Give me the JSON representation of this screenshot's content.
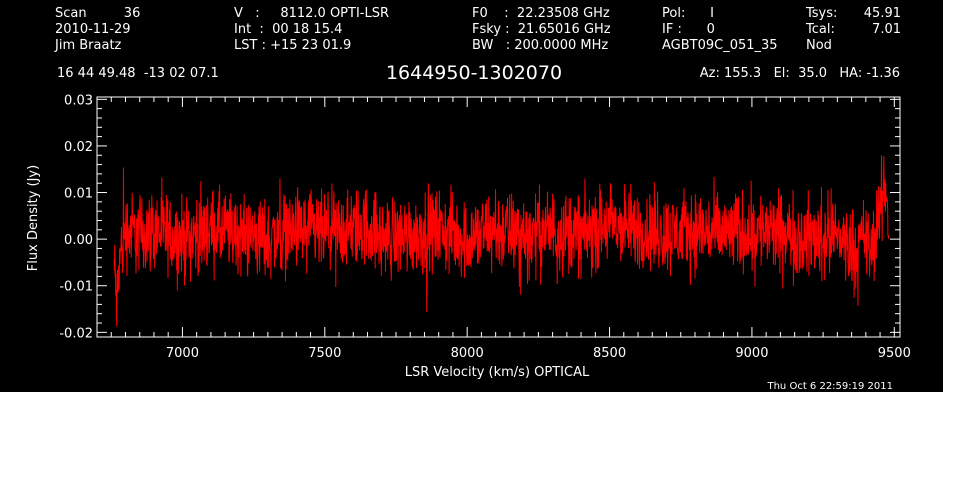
{
  "header": {
    "col1": [
      "Scan         36",
      "2010-11-29",
      "Jim Braatz"
    ],
    "col2": [
      "V   :     8112.0 OPTI-LSR",
      "Int  :  00 18 15.4",
      "LST : +15 23 01.9"
    ],
    "col3": [
      "F0    :  22.23508 GHz",
      "Fsky :  21.65016 GHz",
      "BW   : 200.0000 MHz"
    ],
    "col4": [
      "Pol:      I",
      "IF :      0",
      "AGBT09C_051_35"
    ],
    "col5": [
      "Tsys:",
      "Tcal:",
      "Nod"
    ],
    "col6": [
      "45.91",
      "7.01",
      ""
    ],
    "coords": "16 44 49.48  -13 02 07.1",
    "source": "1644950-1302070",
    "azelha": "Az: 155.3   El:  35.0   HA: -1.36",
    "timestamp": "Thu Oct  6 22:59:19 2011"
  },
  "colors": {
    "background": "#000000",
    "axes": "#ffffff",
    "series": "#ff0000"
  },
  "chart_data": {
    "type": "line",
    "title": "1644950-1302070",
    "xlabel": "LSR Velocity (km/s) OPTICAL",
    "ylabel": "Flux Density (Jy)",
    "xlim": [
      6700,
      9520
    ],
    "ylim": [
      -0.021,
      0.0305
    ],
    "x_ticks": [
      7000,
      7500,
      8000,
      8500,
      9000,
      9500
    ],
    "x_tick_labels": [
      "7000",
      "7500",
      "8000",
      "8500",
      "9000",
      "9500"
    ],
    "y_ticks": [
      -0.02,
      -0.01,
      0.0,
      0.01,
      0.02,
      0.03
    ],
    "y_tick_labels": [
      "-0.02",
      "-0.01",
      "0.00",
      "0.01",
      "0.02",
      "0.03"
    ],
    "grid": false,
    "series": [
      {
        "x": [
          6760,
          6770,
          6780,
          6800,
          6850,
          6900,
          7000,
          7100,
          7200,
          7300,
          7400,
          7500,
          7600,
          7650,
          7700,
          7800,
          7900,
          8000,
          8100,
          8200,
          8300,
          8400,
          8500,
          8600,
          8700,
          8800,
          8900,
          9000,
          9100,
          9200,
          9300,
          9350,
          9400,
          9420,
          9440,
          9450,
          9460,
          9470,
          9480
        ],
        "y": [
          -0.006,
          -0.014,
          -0.004,
          0.002,
          0.001,
          0.002,
          0.0,
          0.002,
          0.001,
          0.0,
          0.002,
          0.001,
          0.002,
          0.003,
          0.0,
          0.001,
          0.002,
          0.0,
          0.002,
          0.001,
          0.002,
          0.001,
          0.003,
          0.002,
          0.001,
          0.002,
          0.001,
          0.002,
          0.001,
          0.0,
          0.001,
          -0.002,
          0.0,
          -0.003,
          0.003,
          0.006,
          0.009,
          0.012,
          0.002
        ]
      }
    ]
  }
}
